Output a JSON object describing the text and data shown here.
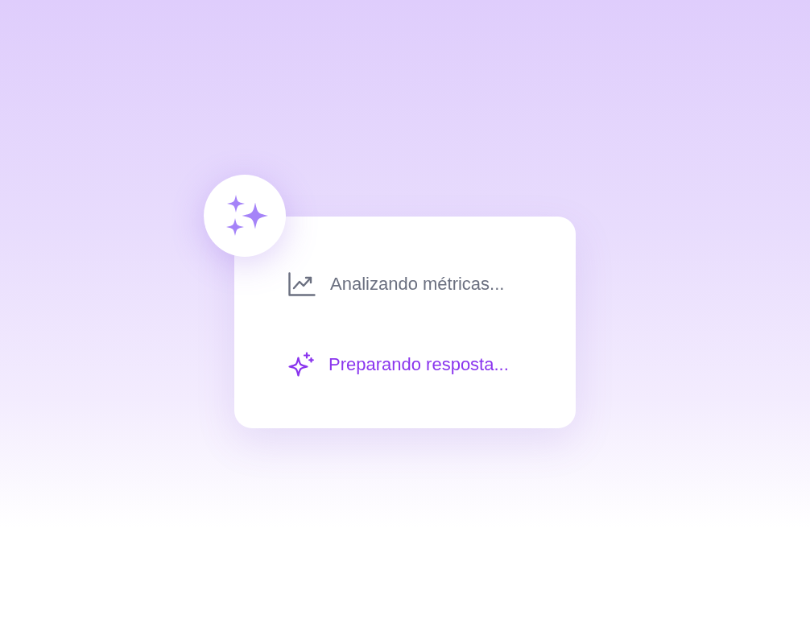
{
  "steps": [
    {
      "label": "Analizando métricas...",
      "kind": "chart",
      "active": false
    },
    {
      "label": "Preparando resposta...",
      "kind": "sparkles",
      "active": true
    }
  ]
}
